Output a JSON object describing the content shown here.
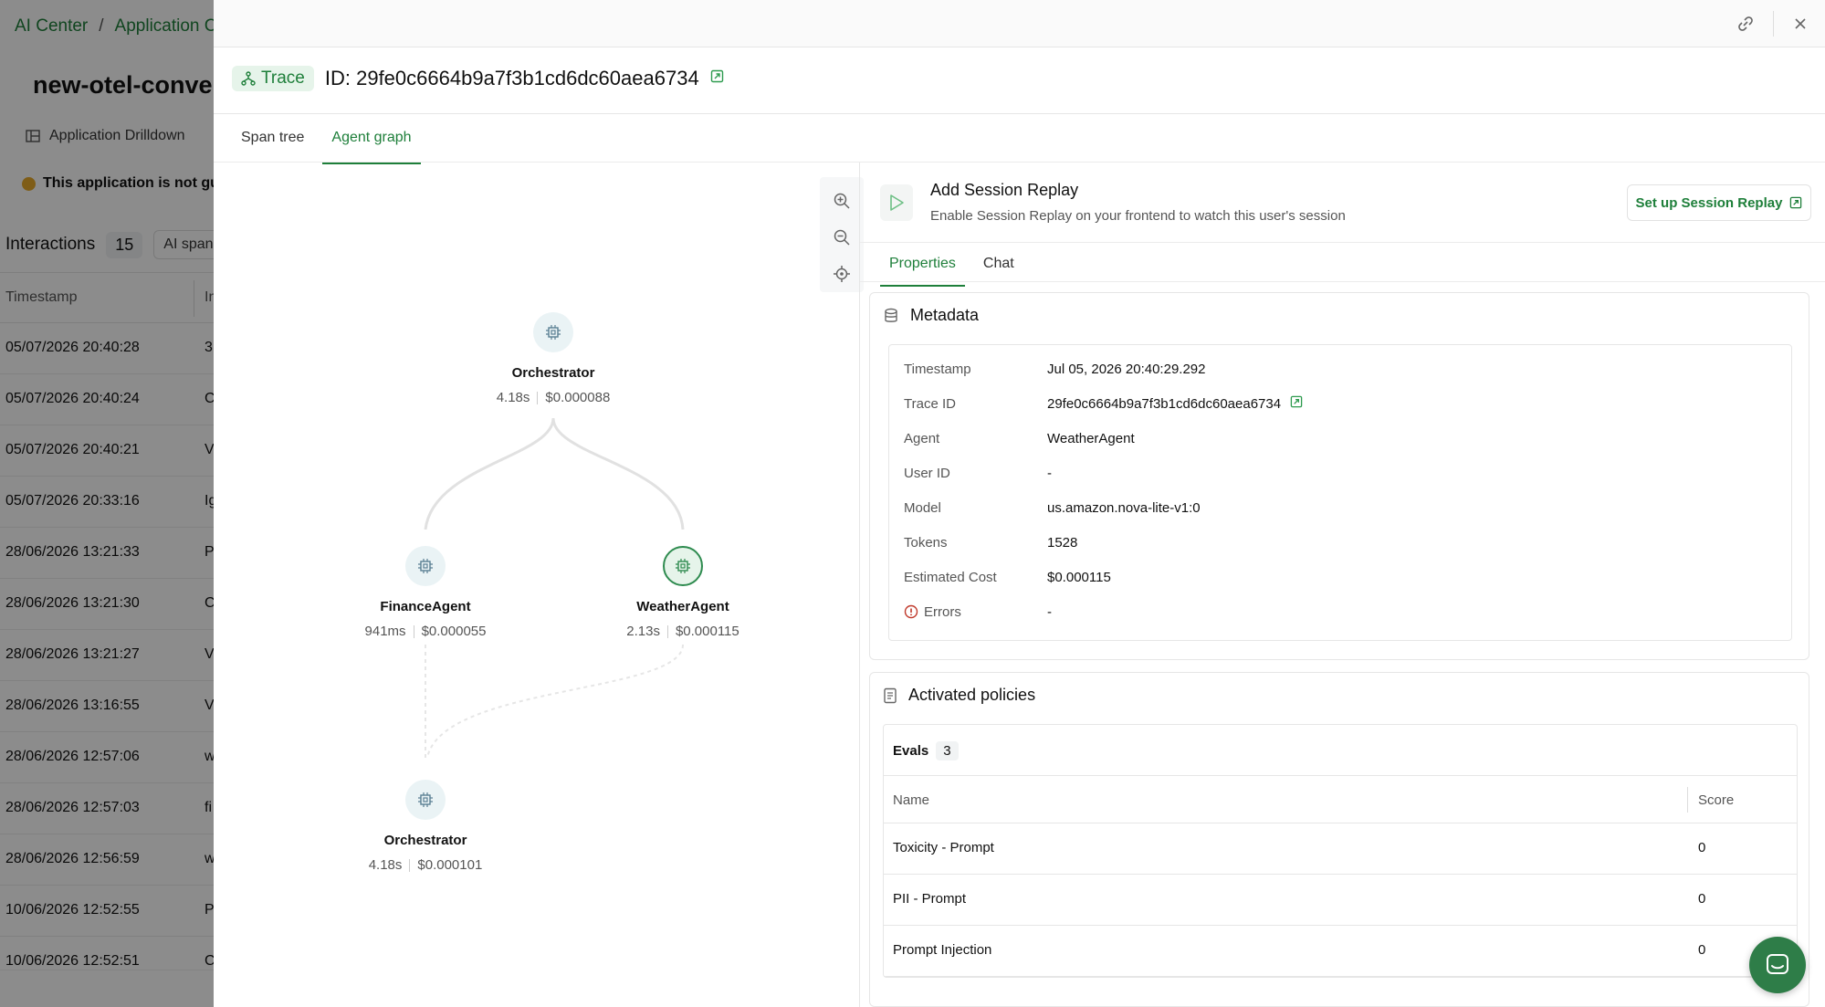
{
  "background": {
    "breadcrumb": [
      "AI Center",
      "Application Ca"
    ],
    "breadcrumb_sep": "/",
    "app_title": "new-otel-conven",
    "drilldown_tab": "Application Drilldown",
    "warning": "This application is not guar",
    "interactions_label": "Interactions",
    "interactions_count": "15",
    "ai_spans_filter": "AI spans",
    "column_timestamp": "Timestamp",
    "column_second": "In",
    "rows": [
      {
        "ts": "05/07/2026 20:40:28",
        "c": "3"
      },
      {
        "ts": "05/07/2026 20:40:24",
        "c": "C"
      },
      {
        "ts": "05/07/2026 20:40:21",
        "c": "V"
      },
      {
        "ts": "05/07/2026 20:33:16",
        "c": "Ig"
      },
      {
        "ts": "28/06/2026 13:21:33",
        "c": "P"
      },
      {
        "ts": "28/06/2026 13:21:30",
        "c": "C"
      },
      {
        "ts": "28/06/2026 13:21:27",
        "c": "V"
      },
      {
        "ts": "28/06/2026 13:16:55",
        "c": "V"
      },
      {
        "ts": "28/06/2026 12:57:06",
        "c": "w"
      },
      {
        "ts": "28/06/2026 12:57:03",
        "c": "fi"
      },
      {
        "ts": "28/06/2026 12:56:59",
        "c": "w"
      },
      {
        "ts": "10/06/2026 12:52:55",
        "c": "P"
      },
      {
        "ts": "10/06/2026 12:52:51",
        "c": "C"
      }
    ]
  },
  "drawer": {
    "trace_badge": "Trace",
    "trace_id": "ID: 29fe0c6664b9a7f3b1cd6dc60aea6734",
    "tabs": [
      {
        "label": "Span tree",
        "active": false
      },
      {
        "label": "Agent graph",
        "active": true
      }
    ]
  },
  "graph": {
    "nodes": [
      {
        "name": "Orchestrator",
        "duration": "4.18s",
        "cost": "$0.000088",
        "selected": false
      },
      {
        "name": "FinanceAgent",
        "duration": "941ms",
        "cost": "$0.000055",
        "selected": false
      },
      {
        "name": "WeatherAgent",
        "duration": "2.13s",
        "cost": "$0.000115",
        "selected": true
      },
      {
        "name": "Orchestrator",
        "duration": "4.18s",
        "cost": "$0.000101",
        "selected": false
      }
    ]
  },
  "replay": {
    "title": "Add Session Replay",
    "subtitle": "Enable Session Replay on your frontend to watch this user's session",
    "button": "Set up Session Replay"
  },
  "right_tabs": [
    {
      "label": "Properties",
      "active": true
    },
    {
      "label": "Chat",
      "active": false
    }
  ],
  "metadata": {
    "title": "Metadata",
    "fields": [
      {
        "key": "Timestamp",
        "value": "Jul 05, 2026 20:40:29.292"
      },
      {
        "key": "Trace ID",
        "value": "29fe0c6664b9a7f3b1cd6dc60aea6734"
      },
      {
        "key": "Agent",
        "value": "WeatherAgent"
      },
      {
        "key": "User ID",
        "value": "-"
      },
      {
        "key": "Model",
        "value": "us.amazon.nova-lite-v1:0"
      },
      {
        "key": "Tokens",
        "value": "1528"
      },
      {
        "key": "Estimated Cost",
        "value": "$0.000115"
      },
      {
        "key": "Errors",
        "value": "-"
      }
    ]
  },
  "policies": {
    "title": "Activated policies",
    "evals_label": "Evals",
    "evals_count": "3",
    "col_name": "Name",
    "col_score": "Score",
    "rows": [
      {
        "name": "Toxicity - Prompt",
        "score": "0"
      },
      {
        "name": "PII - Prompt",
        "score": "0"
      },
      {
        "name": "Prompt Injection",
        "score": "0"
      }
    ]
  },
  "colors": {
    "accent": "#1e7f3a",
    "fab": "#2e7d48",
    "selected_node": "#2e8b4f"
  }
}
